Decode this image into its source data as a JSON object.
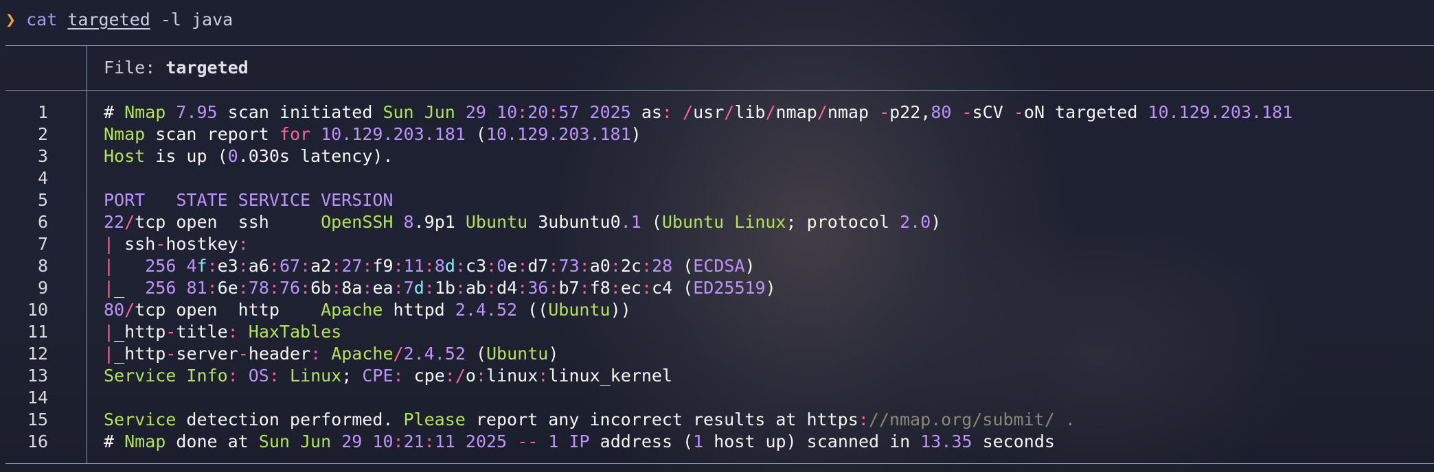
{
  "prompt": {
    "symbol": "❯",
    "command": "cat",
    "file_arg": "targeted",
    "flags": "-l java"
  },
  "file_header": {
    "label": "File: ",
    "name": "targeted"
  },
  "line_numbers": [
    "1",
    "2",
    "3",
    "4",
    "5",
    "6",
    "7",
    "8",
    "9",
    "10",
    "11",
    "12",
    "13",
    "14",
    "15",
    "16"
  ],
  "lines": [
    [
      [
        "w",
        "# "
      ],
      [
        "g",
        "Nmap"
      ],
      [
        "w",
        " "
      ],
      [
        "p",
        "7.95"
      ],
      [
        "w",
        " scan initiated "
      ],
      [
        "g",
        "Sun Jun"
      ],
      [
        "w",
        " "
      ],
      [
        "p",
        "29"
      ],
      [
        "w",
        " "
      ],
      [
        "p",
        "10"
      ],
      [
        "r",
        ":"
      ],
      [
        "p",
        "20"
      ],
      [
        "r",
        ":"
      ],
      [
        "p",
        "57"
      ],
      [
        "w",
        " "
      ],
      [
        "p",
        "2025"
      ],
      [
        "w",
        " as"
      ],
      [
        "r",
        ":"
      ],
      [
        "w",
        " "
      ],
      [
        "r",
        "/"
      ],
      [
        "w",
        "usr"
      ],
      [
        "r",
        "/"
      ],
      [
        "w",
        "lib"
      ],
      [
        "r",
        "/"
      ],
      [
        "w",
        "nmap"
      ],
      [
        "r",
        "/"
      ],
      [
        "w",
        "nmap "
      ],
      [
        "r",
        "-"
      ],
      [
        "w",
        "p22,"
      ],
      [
        "p",
        "80"
      ],
      [
        "w",
        " "
      ],
      [
        "r",
        "-"
      ],
      [
        "w",
        "sCV "
      ],
      [
        "r",
        "-"
      ],
      [
        "w",
        "oN targeted "
      ],
      [
        "p",
        "10.129.203.181"
      ]
    ],
    [
      [
        "g",
        "Nmap"
      ],
      [
        "w",
        " scan report "
      ],
      [
        "r",
        "for"
      ],
      [
        "w",
        " "
      ],
      [
        "p",
        "10.129.203.181"
      ],
      [
        "w",
        " ("
      ],
      [
        "p",
        "10.129.203.181"
      ],
      [
        "w",
        ")"
      ]
    ],
    [
      [
        "g",
        "Host"
      ],
      [
        "w",
        " is up ("
      ],
      [
        "p",
        "0"
      ],
      [
        "w",
        ".030s latency)."
      ]
    ],
    [],
    [
      [
        "p",
        "PORT   STATE SERVICE VERSION"
      ]
    ],
    [
      [
        "p",
        "22"
      ],
      [
        "r",
        "/"
      ],
      [
        "w",
        "tcp open  ssh     "
      ],
      [
        "g",
        "OpenSSH"
      ],
      [
        "w",
        " "
      ],
      [
        "p",
        "8"
      ],
      [
        "w",
        ".9p1 "
      ],
      [
        "g",
        "Ubuntu"
      ],
      [
        "w",
        " 3ubuntu0"
      ],
      [
        "p",
        ".1"
      ],
      [
        "w",
        " ("
      ],
      [
        "g",
        "Ubuntu Linux"
      ],
      [
        "w",
        "; protocol "
      ],
      [
        "p",
        "2.0"
      ],
      [
        "w",
        ")"
      ]
    ],
    [
      [
        "r",
        "|"
      ],
      [
        "w",
        " ssh"
      ],
      [
        "r",
        "-"
      ],
      [
        "w",
        "hostkey"
      ],
      [
        "r",
        ":"
      ]
    ],
    [
      [
        "r",
        "|"
      ],
      [
        "w",
        "   "
      ],
      [
        "p",
        "256"
      ],
      [
        "w",
        " "
      ],
      [
        "p",
        "4"
      ],
      [
        "c",
        "f"
      ],
      [
        "r",
        ":"
      ],
      [
        "w",
        "e3"
      ],
      [
        "r",
        ":"
      ],
      [
        "w",
        "a6"
      ],
      [
        "r",
        ":"
      ],
      [
        "p",
        "67"
      ],
      [
        "r",
        ":"
      ],
      [
        "w",
        "a2"
      ],
      [
        "r",
        ":"
      ],
      [
        "p",
        "27"
      ],
      [
        "r",
        ":"
      ],
      [
        "w",
        "f9"
      ],
      [
        "r",
        ":"
      ],
      [
        "p",
        "11"
      ],
      [
        "r",
        ":"
      ],
      [
        "p",
        "8"
      ],
      [
        "c",
        "d"
      ],
      [
        "r",
        ":"
      ],
      [
        "w",
        "c3"
      ],
      [
        "r",
        ":"
      ],
      [
        "p",
        "0"
      ],
      [
        "w",
        "e"
      ],
      [
        "r",
        ":"
      ],
      [
        "w",
        "d7"
      ],
      [
        "r",
        ":"
      ],
      [
        "p",
        "73"
      ],
      [
        "r",
        ":"
      ],
      [
        "w",
        "a0"
      ],
      [
        "r",
        ":"
      ],
      [
        "w",
        "2c"
      ],
      [
        "r",
        ":"
      ],
      [
        "p",
        "28"
      ],
      [
        "w",
        " ("
      ],
      [
        "p",
        "ECDSA"
      ],
      [
        "w",
        ")"
      ]
    ],
    [
      [
        "r",
        "|"
      ],
      [
        "w",
        "_  "
      ],
      [
        "p",
        "256"
      ],
      [
        "w",
        " "
      ],
      [
        "p",
        "81"
      ],
      [
        "r",
        ":"
      ],
      [
        "w",
        "6e"
      ],
      [
        "r",
        ":"
      ],
      [
        "p",
        "78"
      ],
      [
        "r",
        ":"
      ],
      [
        "p",
        "76"
      ],
      [
        "r",
        ":"
      ],
      [
        "w",
        "6b"
      ],
      [
        "r",
        ":"
      ],
      [
        "w",
        "8a"
      ],
      [
        "r",
        ":"
      ],
      [
        "w",
        "ea"
      ],
      [
        "r",
        ":"
      ],
      [
        "p",
        "7"
      ],
      [
        "c",
        "d"
      ],
      [
        "r",
        ":"
      ],
      [
        "w",
        "1b"
      ],
      [
        "r",
        ":"
      ],
      [
        "w",
        "ab"
      ],
      [
        "r",
        ":"
      ],
      [
        "w",
        "d4"
      ],
      [
        "r",
        ":"
      ],
      [
        "p",
        "36"
      ],
      [
        "r",
        ":"
      ],
      [
        "w",
        "b7"
      ],
      [
        "r",
        ":"
      ],
      [
        "w",
        "f8"
      ],
      [
        "r",
        ":"
      ],
      [
        "w",
        "ec"
      ],
      [
        "r",
        ":"
      ],
      [
        "w",
        "c4 ("
      ],
      [
        "p",
        "ED25519"
      ],
      [
        "w",
        ")"
      ]
    ],
    [
      [
        "p",
        "80"
      ],
      [
        "r",
        "/"
      ],
      [
        "w",
        "tcp open  http    "
      ],
      [
        "g",
        "Apache"
      ],
      [
        "w",
        " httpd "
      ],
      [
        "p",
        "2.4.52"
      ],
      [
        "w",
        " (("
      ],
      [
        "g",
        "Ubuntu"
      ],
      [
        "w",
        "))"
      ]
    ],
    [
      [
        "r",
        "|"
      ],
      [
        "w",
        "_http"
      ],
      [
        "r",
        "-"
      ],
      [
        "w",
        "title"
      ],
      [
        "r",
        ":"
      ],
      [
        "w",
        " "
      ],
      [
        "g",
        "HaxTables"
      ]
    ],
    [
      [
        "r",
        "|"
      ],
      [
        "w",
        "_http"
      ],
      [
        "r",
        "-"
      ],
      [
        "w",
        "server"
      ],
      [
        "r",
        "-"
      ],
      [
        "w",
        "header"
      ],
      [
        "r",
        ":"
      ],
      [
        "w",
        " "
      ],
      [
        "g",
        "Apache"
      ],
      [
        "r",
        "/"
      ],
      [
        "p",
        "2.4.52"
      ],
      [
        "w",
        " ("
      ],
      [
        "g",
        "Ubuntu"
      ],
      [
        "w",
        ")"
      ]
    ],
    [
      [
        "g",
        "Service Info"
      ],
      [
        "r",
        ":"
      ],
      [
        "w",
        " "
      ],
      [
        "p",
        "OS"
      ],
      [
        "r",
        ":"
      ],
      [
        "w",
        " "
      ],
      [
        "g",
        "Linux"
      ],
      [
        "w",
        "; "
      ],
      [
        "p",
        "CPE"
      ],
      [
        "r",
        ":"
      ],
      [
        "w",
        " cpe"
      ],
      [
        "r",
        ":/"
      ],
      [
        "w",
        "o"
      ],
      [
        "r",
        ":"
      ],
      [
        "w",
        "linux"
      ],
      [
        "r",
        ":"
      ],
      [
        "w",
        "linux_kernel"
      ]
    ],
    [],
    [
      [
        "g",
        "Service"
      ],
      [
        "w",
        " detection performed. "
      ],
      [
        "g",
        "Please"
      ],
      [
        "w",
        " report any incorrect results at https"
      ],
      [
        "r",
        ":"
      ],
      [
        "d",
        "//nmap.org/submit/ ."
      ]
    ],
    [
      [
        "w",
        "# "
      ],
      [
        "g",
        "Nmap"
      ],
      [
        "w",
        " done at "
      ],
      [
        "g",
        "Sun Jun"
      ],
      [
        "w",
        " "
      ],
      [
        "p",
        "29"
      ],
      [
        "w",
        " "
      ],
      [
        "p",
        "10"
      ],
      [
        "r",
        ":"
      ],
      [
        "p",
        "21"
      ],
      [
        "r",
        ":"
      ],
      [
        "p",
        "11"
      ],
      [
        "w",
        " "
      ],
      [
        "p",
        "2025"
      ],
      [
        "w",
        " "
      ],
      [
        "r",
        "--"
      ],
      [
        "w",
        " "
      ],
      [
        "p",
        "1"
      ],
      [
        "w",
        " "
      ],
      [
        "p",
        "IP"
      ],
      [
        "w",
        " address ("
      ],
      [
        "p",
        "1"
      ],
      [
        "w",
        " host up) scanned in "
      ],
      [
        "p",
        "13.35"
      ],
      [
        "w",
        " seconds"
      ]
    ]
  ],
  "colors": {
    "background": "#1c1f2e",
    "prompt_symbol": "#f5a33b",
    "command": "#a19cf0",
    "border": "#8d98ac",
    "green": "#b6e05c",
    "purple": "#bd93f9",
    "pink": "#ff5f9e",
    "cyan": "#8be9fd",
    "white": "#f3f3f3",
    "dim": "#8a8678"
  }
}
